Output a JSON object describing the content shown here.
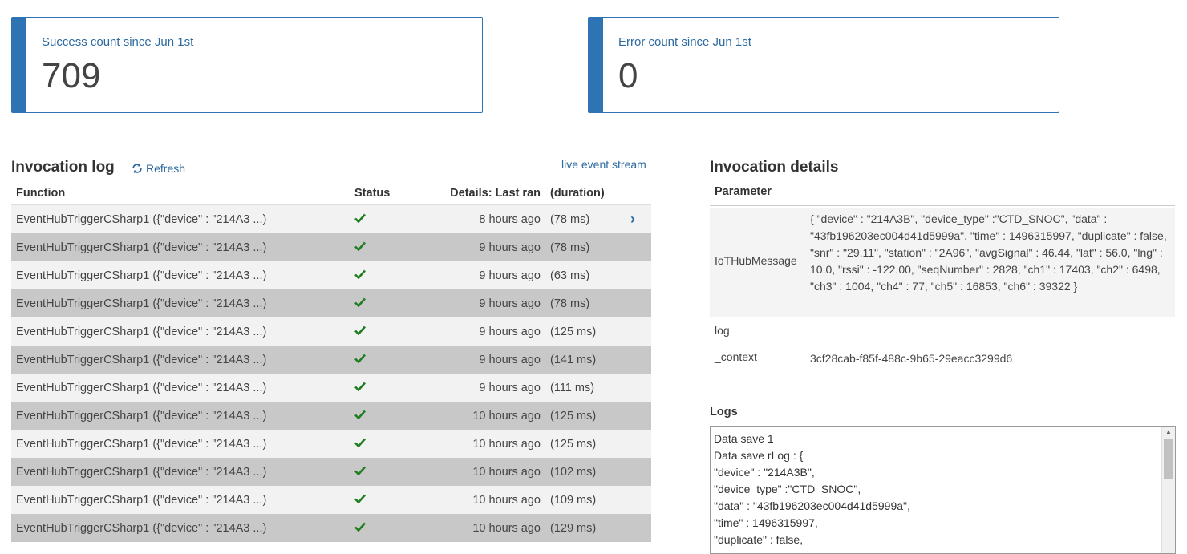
{
  "cards": {
    "success": {
      "label": "Success count since Jun 1st",
      "count": "709"
    },
    "error": {
      "label": "Error count since Jun 1st",
      "count": "0"
    }
  },
  "invocation_log": {
    "title": "Invocation log",
    "refresh_label": "Refresh",
    "live_link": "live event stream",
    "columns": {
      "function": "Function",
      "status": "Status",
      "last_ran": "Details: Last ran",
      "duration": "(duration)"
    },
    "rows": [
      {
        "function": "EventHubTriggerCSharp1 ({\"device\" : \"214A3 ...)",
        "last_ran": "8 hours ago",
        "duration": "(78 ms)"
      },
      {
        "function": "EventHubTriggerCSharp1 ({\"device\" : \"214A3 ...)",
        "last_ran": "9 hours ago",
        "duration": "(78 ms)"
      },
      {
        "function": "EventHubTriggerCSharp1 ({\"device\" : \"214A3 ...)",
        "last_ran": "9 hours ago",
        "duration": "(63 ms)"
      },
      {
        "function": "EventHubTriggerCSharp1 ({\"device\" : \"214A3 ...)",
        "last_ran": "9 hours ago",
        "duration": "(78 ms)"
      },
      {
        "function": "EventHubTriggerCSharp1 ({\"device\" : \"214A3 ...)",
        "last_ran": "9 hours ago",
        "duration": "(125 ms)"
      },
      {
        "function": "EventHubTriggerCSharp1 ({\"device\" : \"214A3 ...)",
        "last_ran": "9 hours ago",
        "duration": "(141 ms)"
      },
      {
        "function": "EventHubTriggerCSharp1 ({\"device\" : \"214A3 ...)",
        "last_ran": "9 hours ago",
        "duration": "(111 ms)"
      },
      {
        "function": "EventHubTriggerCSharp1 ({\"device\" : \"214A3 ...)",
        "last_ran": "10 hours ago",
        "duration": "(125 ms)"
      },
      {
        "function": "EventHubTriggerCSharp1 ({\"device\" : \"214A3 ...)",
        "last_ran": "10 hours ago",
        "duration": "(125 ms)"
      },
      {
        "function": "EventHubTriggerCSharp1 ({\"device\" : \"214A3 ...)",
        "last_ran": "10 hours ago",
        "duration": "(102 ms)"
      },
      {
        "function": "EventHubTriggerCSharp1 ({\"device\" : \"214A3 ...)",
        "last_ran": "10 hours ago",
        "duration": "(109 ms)"
      },
      {
        "function": "EventHubTriggerCSharp1 ({\"device\" : \"214A3 ...)",
        "last_ran": "10 hours ago",
        "duration": "(129 ms)"
      }
    ]
  },
  "details": {
    "title": "Invocation details",
    "param_header": "Parameter",
    "params": {
      "iot_key": "IoTHubMessage",
      "iot_value": "{ \"device\" : \"214A3B\", \"device_type\" :\"CTD_SNOC\", \"data\" : \"43fb196203ec004d41d5999a\", \"time\" : 1496315997, \"duplicate\" : false, \"snr\" : \"29.11\", \"station\" : \"2A96\", \"avgSignal\" : 46.44, \"lat\" : 56.0, \"lng\" : 10.0, \"rssi\" : -122.00, \"seqNumber\" : 2828, \"ch1\" : 17403,  \"ch2\" : 6498,  \"ch3\" : 1004,  \"ch4\" : 77,  \"ch5\" : 16853,  \"ch6\" : 39322  }",
      "log_key": "log",
      "context_key": "_context",
      "context_value": "3cf28cab-f85f-488c-9b65-29eacc3299d6"
    },
    "logs_title": "Logs",
    "logs_lines": [
      "Data save 1",
      "Data save rLog : {",
      "\"device\" : \"214A3B\",",
      "\"device_type\" :\"CTD_SNOC\",",
      "\"data\" : \"43fb196203ec004d41d5999a\",",
      "\"time\" : 1496315997,",
      "\"duplicate\" : false,"
    ]
  },
  "colors": {
    "accent": "#2e74b5",
    "link": "#2c6aa0",
    "success": "#1e7e1e"
  }
}
